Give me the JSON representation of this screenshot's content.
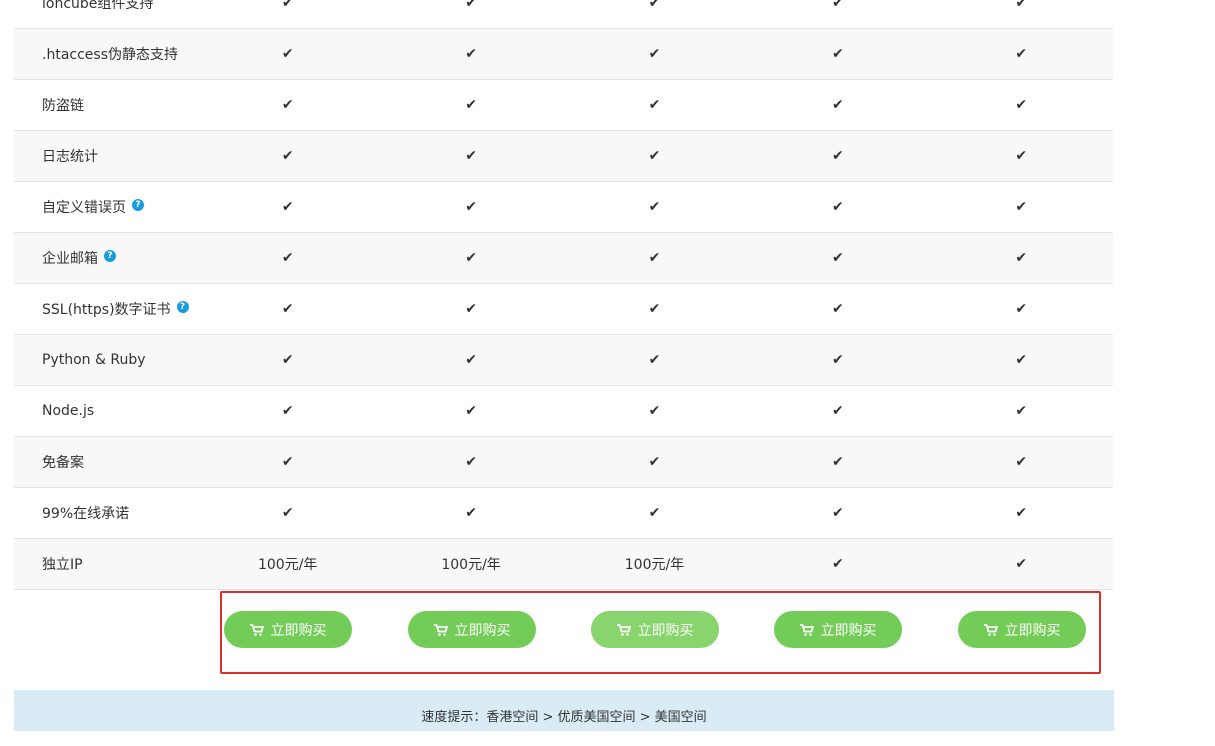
{
  "table": {
    "check_glyph": "✔",
    "help_glyph": "?",
    "check_color": "#6dc24b",
    "rows": [
      {
        "feature": "ioncube组件支持",
        "help": false,
        "cells": [
          "✔",
          "✔",
          "✔",
          "✔",
          "✔"
        ]
      },
      {
        "feature": ".htaccess伪静态支持",
        "help": false,
        "cells": [
          "✔",
          "✔",
          "✔",
          "✔",
          "✔"
        ]
      },
      {
        "feature": "防盗链",
        "help": false,
        "cells": [
          "✔",
          "✔",
          "✔",
          "✔",
          "✔"
        ]
      },
      {
        "feature": "日志统计",
        "help": false,
        "cells": [
          "✔",
          "✔",
          "✔",
          "✔",
          "✔"
        ]
      },
      {
        "feature": "自定义错误页",
        "help": true,
        "cells": [
          "✔",
          "✔",
          "✔",
          "✔",
          "✔"
        ]
      },
      {
        "feature": "企业邮箱",
        "help": true,
        "cells": [
          "✔",
          "✔",
          "✔",
          "✔",
          "✔"
        ]
      },
      {
        "feature": "SSL(https)数字证书",
        "help": true,
        "cells": [
          "✔",
          "✔",
          "✔",
          "✔",
          "✔"
        ]
      },
      {
        "feature": "Python & Ruby",
        "help": false,
        "cells": [
          "✔",
          "✔",
          "✔",
          "✔",
          "✔"
        ]
      },
      {
        "feature": "Node.js",
        "help": false,
        "cells": [
          "✔",
          "✔",
          "✔",
          "✔",
          "✔"
        ]
      },
      {
        "feature": "免备案",
        "help": false,
        "cells": [
          "✔",
          "✔",
          "✔",
          "✔",
          "✔"
        ]
      },
      {
        "feature": "99%在线承诺",
        "help": false,
        "cells": [
          "✔",
          "✔",
          "✔",
          "✔",
          "✔"
        ]
      },
      {
        "feature": "独立IP",
        "help": false,
        "cells": [
          "100元/年",
          "100元/年",
          "100元/年",
          "✔",
          "✔"
        ]
      }
    ]
  },
  "buy_buttons": [
    {
      "label": "立即购买"
    },
    {
      "label": "立即购买"
    },
    {
      "label": "立即购买"
    },
    {
      "label": "立即购买"
    },
    {
      "label": "立即购买"
    }
  ],
  "footer": {
    "tip": "速度提示：香港空间 > 优质美国空间 > 美国空间"
  },
  "colors": {
    "button_green": "#74cc58",
    "highlight_border": "#e02b2b",
    "footer_bg": "#d9ebf5",
    "help_blue": "#1a9be0"
  }
}
